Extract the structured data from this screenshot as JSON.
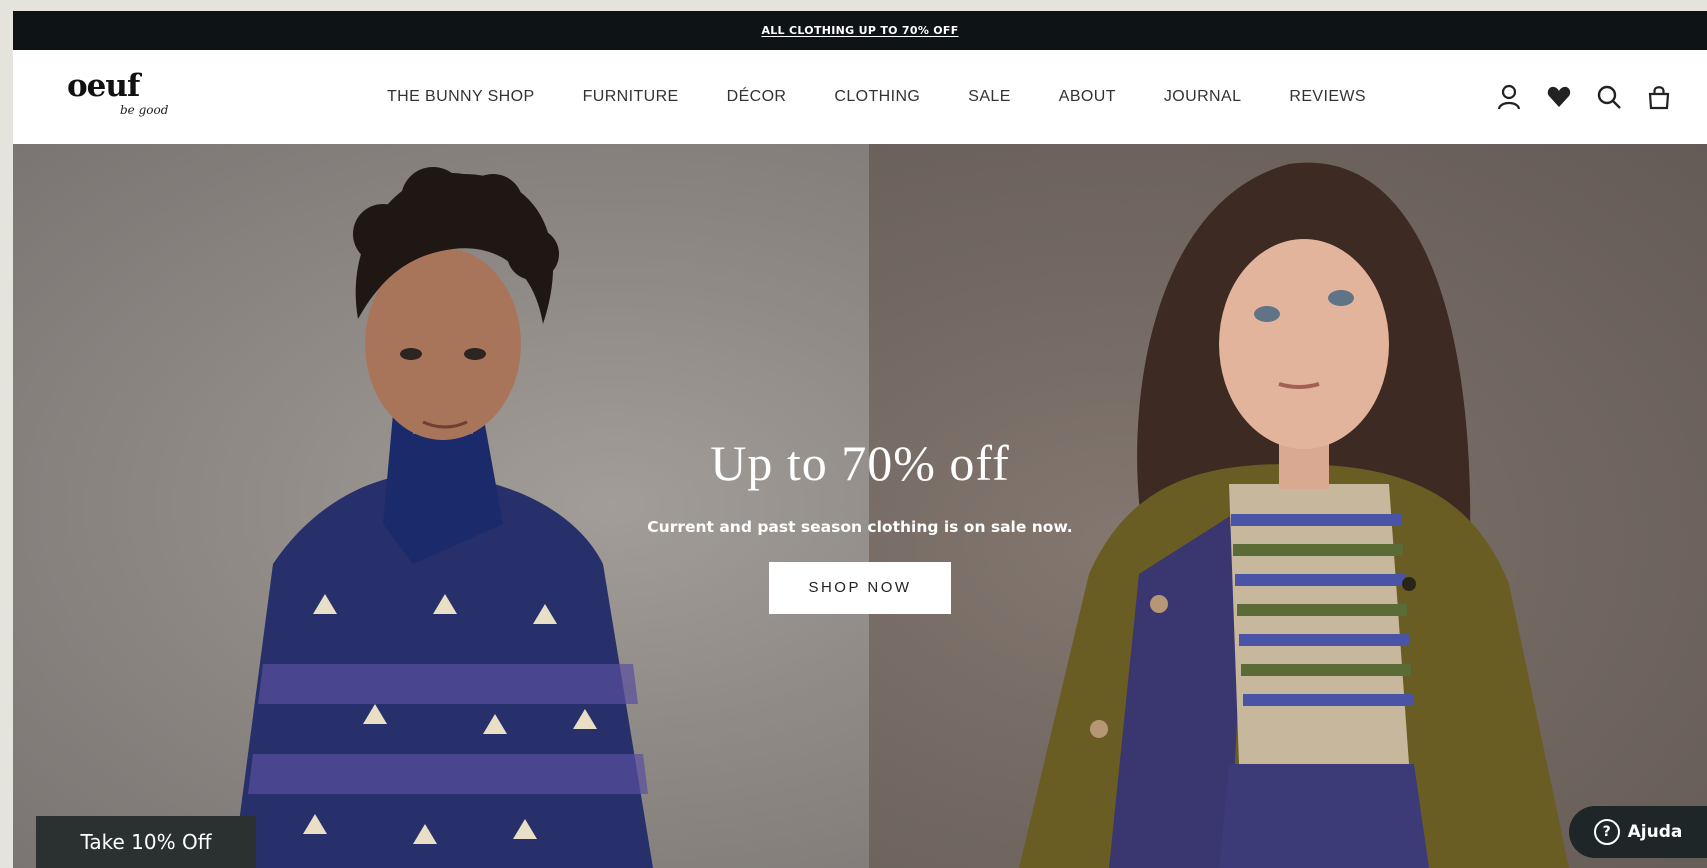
{
  "announcement": {
    "text": "ALL CLOTHING UP TO 70% OFF"
  },
  "brand": {
    "name": "oeuf",
    "tagline": "be good"
  },
  "nav": {
    "items": [
      "THE BUNNY SHOP",
      "FURNITURE",
      "DÉCOR",
      "CLOTHING",
      "SALE",
      "ABOUT",
      "JOURNAL",
      "REVIEWS"
    ]
  },
  "header_icons": [
    "account-icon",
    "wishlist-heart-icon",
    "search-icon",
    "cart-bag-icon"
  ],
  "hero": {
    "title": "Up to 70% off",
    "subtitle": "Current and past season clothing is on sale now.",
    "cta_label": "SHOP NOW"
  },
  "discount_tab": {
    "label": "Take 10% Off"
  },
  "help_widget": {
    "label": "Ajuda",
    "icon": "help-question-icon"
  },
  "colors": {
    "announcement_bg": "#0e1416",
    "header_bg": "#ffffff",
    "discount_bg": "#2b3031",
    "help_bg": "#1e2628"
  }
}
